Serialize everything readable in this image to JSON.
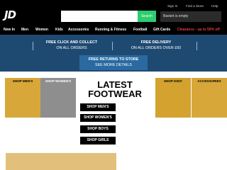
{
  "header": {
    "logo": "JD",
    "search_placeholder": "",
    "search_button": "Search",
    "basket": "Basket is empty",
    "links": [
      "Sign In",
      "Find a Store",
      "Help"
    ]
  },
  "nav": {
    "items": [
      "New In",
      "Men",
      "Women",
      "Kids",
      "Accessories",
      "Running & Fitness",
      "Football",
      "Gift Cards",
      "Clearance - up to 50% off"
    ]
  },
  "promo": {
    "left": [
      "FREE CLICK AND COLLECT",
      "ON ALL ORDERS"
    ],
    "right": [
      "FREE DELIVERY",
      "ON ALL ORDERS OVER £60"
    ],
    "center": [
      "FREE RETURNS TO STORE",
      "SEE MORE DETAILS"
    ]
  },
  "tiles": {
    "mens": "SHOP MEN'S",
    "womens": "SHOP WOMEN'S",
    "kids": "SHOP KIDS'",
    "accessories": "ACCESSORIES"
  },
  "feature": {
    "title_line1": "LATEST",
    "title_line2": "FOOTWEAR",
    "buttons": [
      "SHOP MEN'S",
      "SHOP WOMEN'S",
      "SHOP BOYS",
      "SHOP GIRLS"
    ]
  },
  "colors": {
    "header_bg": "#000000",
    "promo_bg": "#1e4a72",
    "search_button": "#2ecc71",
    "clearance": "#e23c3c"
  }
}
